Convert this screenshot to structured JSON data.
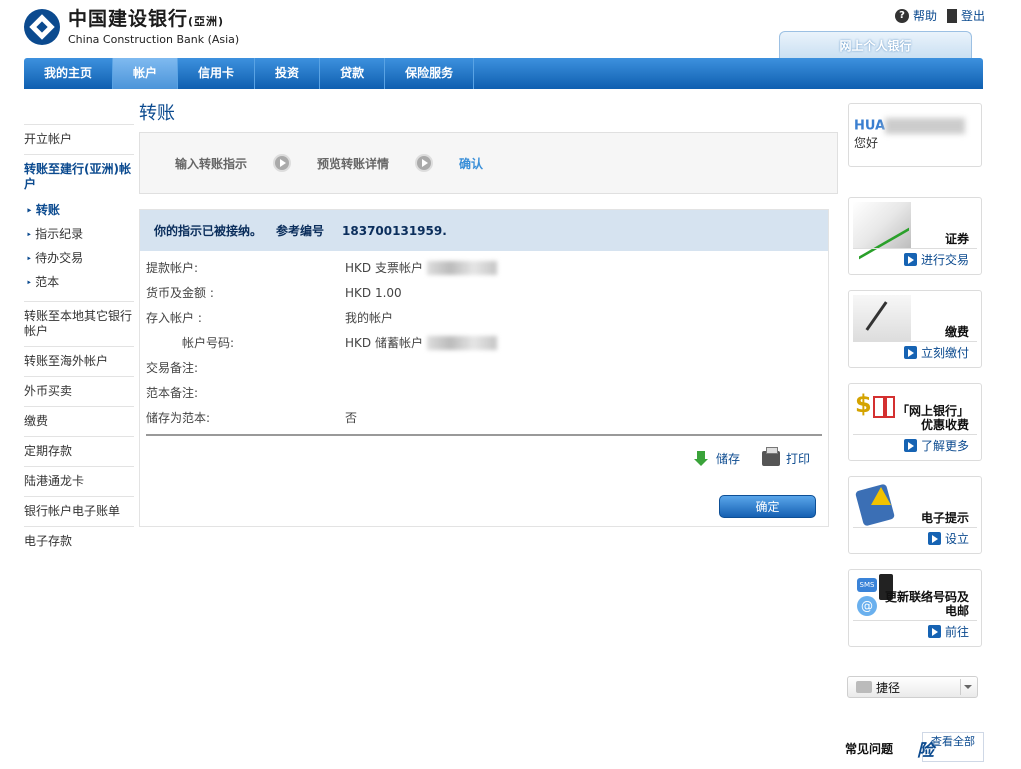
{
  "header": {
    "logo_cn": "中国建设银行",
    "logo_cn_suffix": "(亞洲)",
    "logo_en": "China Construction Bank (Asia)",
    "help": "帮助",
    "logout": "登出",
    "bank_tab": "网上个人银行"
  },
  "nav": [
    "我的主页",
    "帐户",
    "信用卡",
    "投资",
    "贷款",
    "保险服务"
  ],
  "sidebar": {
    "open_account": "开立帐户",
    "group_head": "转账至建行(亚洲)帐户",
    "sub": [
      "转账",
      "指示纪录",
      "待办交易",
      "范本"
    ],
    "items": [
      "转账至本地其它银行帐户",
      "转账至海外帐户",
      "外币买卖",
      "缴费",
      "定期存款",
      "陆港通龙卡",
      "银行帐户电子账单",
      "电子存款"
    ]
  },
  "main": {
    "title": "转账",
    "steps": [
      "输入转账指示",
      "预览转账详情",
      "确认"
    ],
    "result_msg": "你的指示已被接纳。",
    "ref_label": "参考编号",
    "ref_no": "183700131959.",
    "rows": [
      {
        "k": "提款帐户:",
        "v": "HKD 支票帐户"
      },
      {
        "k": "货币及金额 :",
        "v": "HKD 1.00"
      },
      {
        "k": "存入帐户 :",
        "v": "我的帐户"
      },
      {
        "k": "帐户号码:",
        "v": "HKD 储蓄帐户"
      },
      {
        "k": "交易备注:",
        "v": ""
      },
      {
        "k": "范本备注:",
        "v": ""
      },
      {
        "k": "储存为范本:",
        "v": "否"
      }
    ],
    "save": "储存",
    "print": "打印",
    "confirm": "确定"
  },
  "right": {
    "user_name": "HUA",
    "greeting": "您好",
    "promos": [
      {
        "title": "证券",
        "link": "进行交易"
      },
      {
        "title": "缴费",
        "link": "立刻缴付"
      },
      {
        "title": "「网上银行」优惠收费",
        "link": "了解更多"
      },
      {
        "title": "电子提示",
        "link": "设立"
      },
      {
        "title": "更新联络号码及电邮",
        "link": "前往"
      }
    ],
    "shortcut": "捷径",
    "faq": "常见问题",
    "viewall": "查看全部"
  },
  "watermark": "险"
}
